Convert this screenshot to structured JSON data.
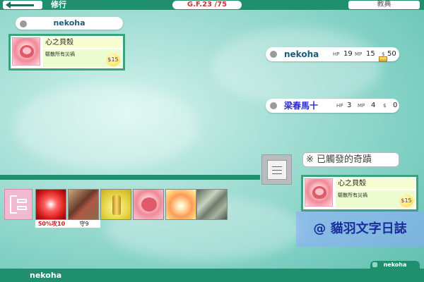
{
  "header": {
    "title": "修行",
    "gf_label": "G.F.",
    "gf_current": "23",
    "gf_total": "/75",
    "tutorial_label": "教典"
  },
  "player": {
    "name": "nekoha",
    "selected_card": {
      "name": "心之貝殼",
      "desc": "驅散所有災禍",
      "price": "$15"
    }
  },
  "opponents": [
    {
      "name": "nekoha",
      "hp_label": "HP",
      "hp": "19",
      "mp_label": "MP",
      "mp": "15",
      "money_label": "$",
      "money": "50"
    },
    {
      "name": "梁春馬十",
      "hp_label": "HP",
      "hp": "3",
      "mp_label": "MP",
      "mp": "4",
      "money_label": "$",
      "money": "0"
    }
  ],
  "triggered": {
    "label": "※ 已觸發的奇蹟",
    "card": {
      "name": "心之貝殼",
      "desc": "驅散所有災禍",
      "price": "$15"
    }
  },
  "hand": [
    {
      "label": "50%攻10"
    },
    {
      "label": "守9"
    },
    {
      "label": ""
    },
    {
      "label": ""
    },
    {
      "label": ""
    },
    {
      "label": ""
    }
  ],
  "watermark": "@ 貓羽文字日誌",
  "footer": {
    "player_name": "nekoha",
    "pill_name": "nekoha"
  }
}
